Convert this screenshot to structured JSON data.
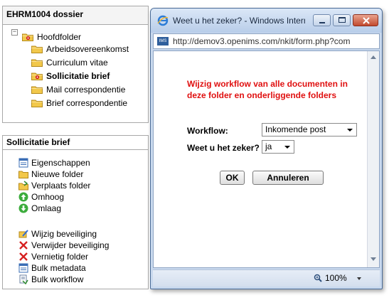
{
  "dossier_panel": {
    "title": "EHRM1004 dossier",
    "tree": [
      {
        "label": "Hoofdfolder",
        "level": 0,
        "special": true,
        "bold": false
      },
      {
        "label": "Arbeidsovereenkomst",
        "level": 1,
        "special": false,
        "bold": false
      },
      {
        "label": "Curriculum vitae",
        "level": 1,
        "special": false,
        "bold": false
      },
      {
        "label": "Sollicitatie brief",
        "level": 1,
        "special": true,
        "bold": true
      },
      {
        "label": "Mail correspondentie",
        "level": 1,
        "special": false,
        "bold": false
      },
      {
        "label": "Brief correspondentie",
        "level": 1,
        "special": false,
        "bold": false
      }
    ],
    "toggle_symbol": "−"
  },
  "actions_panel": {
    "title": "Sollicitatie brief",
    "items": [
      {
        "label": "Eigenschappen",
        "icon": "properties-icon"
      },
      {
        "label": "Nieuwe folder",
        "icon": "new-folder-icon"
      },
      {
        "label": "Verplaats folder",
        "icon": "move-folder-icon"
      },
      {
        "label": "Omhoog",
        "icon": "arrow-up-icon"
      },
      {
        "label": "Omlaag",
        "icon": "arrow-down-icon"
      },
      {
        "label": "Wijzig beveiliging",
        "icon": "security-edit-icon"
      },
      {
        "label": "Verwijder beveiliging",
        "icon": "remove-security-icon"
      },
      {
        "label": "Vernietig folder",
        "icon": "destroy-folder-icon"
      },
      {
        "label": "Bulk metadata",
        "icon": "bulk-metadata-icon"
      },
      {
        "label": "Bulk workflow",
        "icon": "bulk-workflow-icon"
      }
    ]
  },
  "dialog": {
    "title": "Weet u het zeker? - Windows Intern...",
    "address": "http://demov3.openims.com/nkit/form.php?com",
    "address_icon_text": "IMS",
    "warning": "Wijzig workflow van alle documenten in deze folder en onderliggende folders",
    "workflow_label": "Workflow:",
    "workflow_value": "Inkomende post",
    "confirm_label": "Weet u het zeker?",
    "confirm_value": "ja",
    "ok_label": "OK",
    "cancel_label": "Annuleren",
    "zoom": "100%"
  },
  "colors": {
    "warning": "#e01010",
    "folder": "#f2c84b",
    "window_frame": "#c9d9ee"
  }
}
